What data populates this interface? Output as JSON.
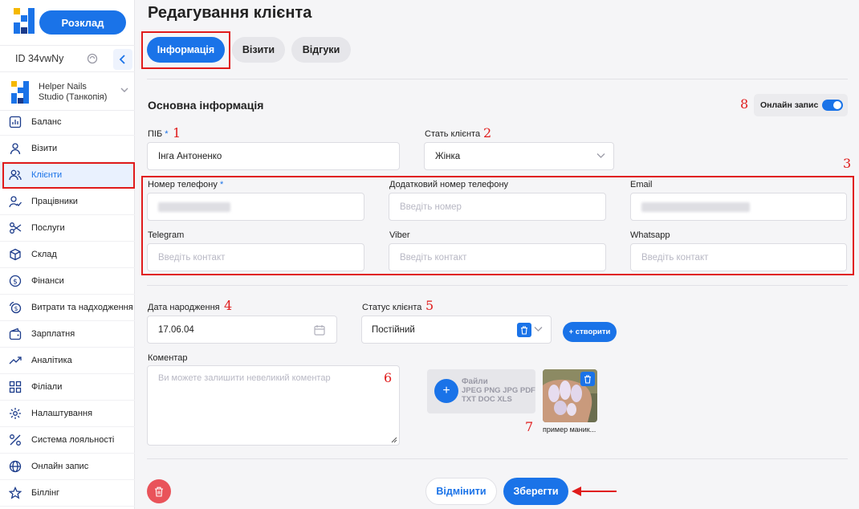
{
  "sidebar": {
    "schedule_label": "Розклад",
    "id_label": "ID 34vwNy",
    "studio_name": "Helper Nails Studio (Танкопія)",
    "items": [
      {
        "label": "Баланс",
        "icon": "chart-icon"
      },
      {
        "label": "Візити",
        "icon": "user-icon"
      },
      {
        "label": "Клієнти",
        "icon": "users-icon",
        "active": true
      },
      {
        "label": "Працівники",
        "icon": "staff-icon"
      },
      {
        "label": "Послуги",
        "icon": "scissors-icon"
      },
      {
        "label": "Склад",
        "icon": "box-icon"
      },
      {
        "label": "Фінанси",
        "icon": "dollar-icon"
      },
      {
        "label": "Витрати та надходження",
        "icon": "money-flow-icon"
      },
      {
        "label": "Зарплатня",
        "icon": "wallet-icon"
      },
      {
        "label": "Аналітика",
        "icon": "trend-icon"
      },
      {
        "label": "Філіали",
        "icon": "grid-icon"
      },
      {
        "label": "Налаштування",
        "icon": "gear-icon"
      },
      {
        "label": "Система лояльності",
        "icon": "percent-icon"
      },
      {
        "label": "Онлайн запис",
        "icon": "globe-icon"
      },
      {
        "label": "Біллінг",
        "icon": "star-icon"
      }
    ]
  },
  "header": {
    "title": "Редагування клієнта",
    "tabs": [
      "Інформація",
      "Візити",
      "Відгуки"
    ]
  },
  "section": {
    "title": "Основна інформація",
    "online_label": "Онлайн запис"
  },
  "form": {
    "name_label": "ПІБ",
    "name_value": "Інга Антоненко",
    "gender_label": "Стать клієнта",
    "gender_value": "Жінка",
    "phone_label": "Номер телефону",
    "extra_phone_label": "Додатковий номер телефону",
    "extra_phone_placeholder": "Введіть номер",
    "email_label": "Email",
    "telegram_label": "Telegram",
    "viber_label": "Viber",
    "whatsapp_label": "Whatsapp",
    "contact_placeholder": "Введіть контакт",
    "birthday_label": "Дата народження",
    "birthday_value": "17.06.04",
    "status_label": "Статус клієнта",
    "status_value": "Постійний",
    "create_label": "+ створити",
    "comment_label": "Коментар",
    "comment_placeholder": "Ви можете залишити невеликий коментар",
    "files_title": "Файли",
    "files_formats": "JPEG PNG JPG PDF",
    "files_formats2": "TXT DOC XLS",
    "file_caption": "пример маник..."
  },
  "actions": {
    "cancel_label": "Відмінити",
    "save_label": "Зберегти"
  },
  "annotations": [
    "1",
    "2",
    "3",
    "4",
    "5",
    "6",
    "7",
    "8"
  ],
  "colors": {
    "accent": "#1a73e8",
    "highlight": "#e01b1b",
    "danger": "#e9535a"
  }
}
